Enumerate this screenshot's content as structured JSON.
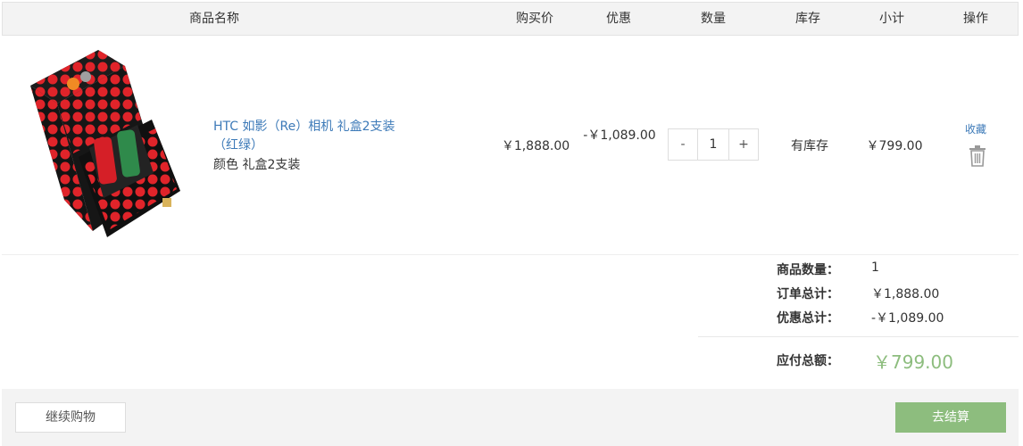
{
  "table_header": {
    "columns": [
      "商品名称",
      "购买价",
      "优惠",
      "数量",
      "库存",
      "小计",
      "操作"
    ]
  },
  "item": {
    "name": "HTC 如影（Re）相机 礼盒2支装（红绿）",
    "variant": "颜色 礼盒2支装",
    "price": "￥1,888.00",
    "discount": "-￥1,089.00",
    "quantity": "1",
    "qty_minus": "-",
    "qty_plus": "+",
    "stock": "有库存",
    "subtotal": "￥799.00",
    "favorite_label": "收藏",
    "delete_icon": "trash-icon",
    "image_icon": "product-gift-box-image"
  },
  "summary": {
    "count_label": "商品数量：",
    "count_value": "1",
    "order_total_label": "订单总计：",
    "order_total_value": "￥1,888.00",
    "discount_total_label": "优惠总计：",
    "discount_total_value": "-￥1,089.00",
    "payable_label": "应付总额：",
    "payable_value": "￥799.00"
  },
  "footer": {
    "continue_label": "继续购物",
    "checkout_label": "去结算"
  },
  "colors": {
    "accent_green": "#8dbd7e",
    "link_blue": "#3d7ab8",
    "header_bg": "#f3f3f3"
  }
}
